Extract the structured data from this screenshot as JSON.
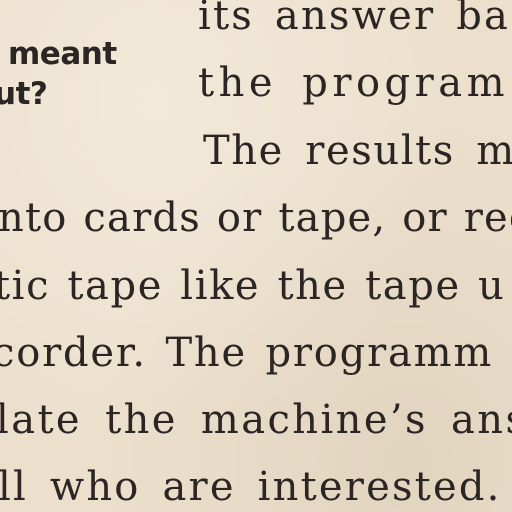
{
  "sidebar": {
    "line_1": "meant",
    "line_2": "ut?"
  },
  "body_text": {
    "line_1": "its answer ba",
    "line_2": "the program",
    "line_3": "The results m",
    "line_4": "nto cards or tape, or rec",
    "line_5": "tic tape like the tape u",
    "line_6": "corder. The programm",
    "line_7": "late the machine’s ans",
    "line_8": "ll who are interested."
  },
  "colors": {
    "paper": "#ece0cd",
    "ink": "#2b2623"
  }
}
